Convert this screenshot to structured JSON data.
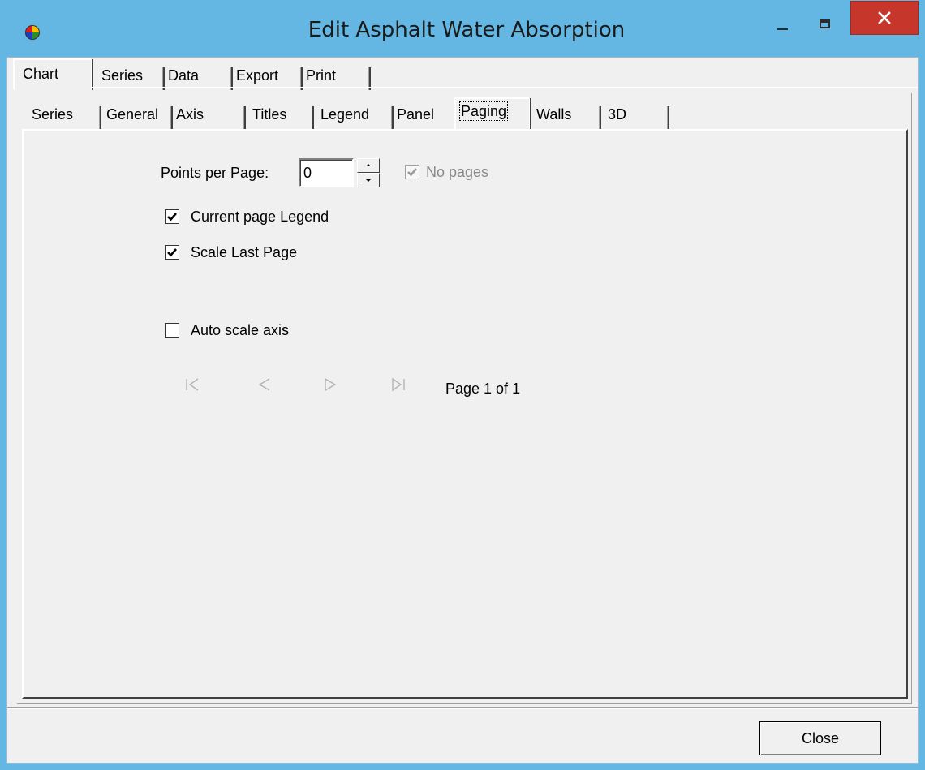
{
  "window": {
    "title": "Edit Asphalt Water Absorption"
  },
  "outer_tabs": [
    {
      "label": "Chart",
      "selected": true
    },
    {
      "label": "Series",
      "selected": false
    },
    {
      "label": "Data",
      "selected": false
    },
    {
      "label": "Export",
      "selected": false
    },
    {
      "label": "Print",
      "selected": false
    }
  ],
  "inner_tabs": [
    {
      "label": "Series",
      "selected": false
    },
    {
      "label": "General",
      "selected": false
    },
    {
      "label": "Axis",
      "selected": false
    },
    {
      "label": "Titles",
      "selected": false
    },
    {
      "label": "Legend",
      "selected": false
    },
    {
      "label": "Panel",
      "selected": false
    },
    {
      "label": "Paging",
      "selected": true
    },
    {
      "label": "Walls",
      "selected": false
    },
    {
      "label": "3D",
      "selected": false
    }
  ],
  "paging": {
    "points_per_page_label": "Points per Page:",
    "points_per_page_value": "0",
    "no_pages_label": "No pages",
    "no_pages_checked": true,
    "current_page_legend_label": "Current page Legend",
    "current_page_legend_checked": true,
    "scale_last_page_label": "Scale Last Page",
    "scale_last_page_checked": true,
    "auto_scale_axis_label": "Auto scale axis",
    "auto_scale_axis_checked": false,
    "page_status": "Page 1 of 1",
    "nav_icons": [
      "first-page-icon",
      "previous-page-icon",
      "next-page-icon",
      "last-page-icon"
    ]
  },
  "footer": {
    "close_label": "Close"
  },
  "colors": {
    "title_bar": "#63b7e2",
    "close_button": "#c7362b",
    "dialog_face": "#f0f0f0"
  }
}
